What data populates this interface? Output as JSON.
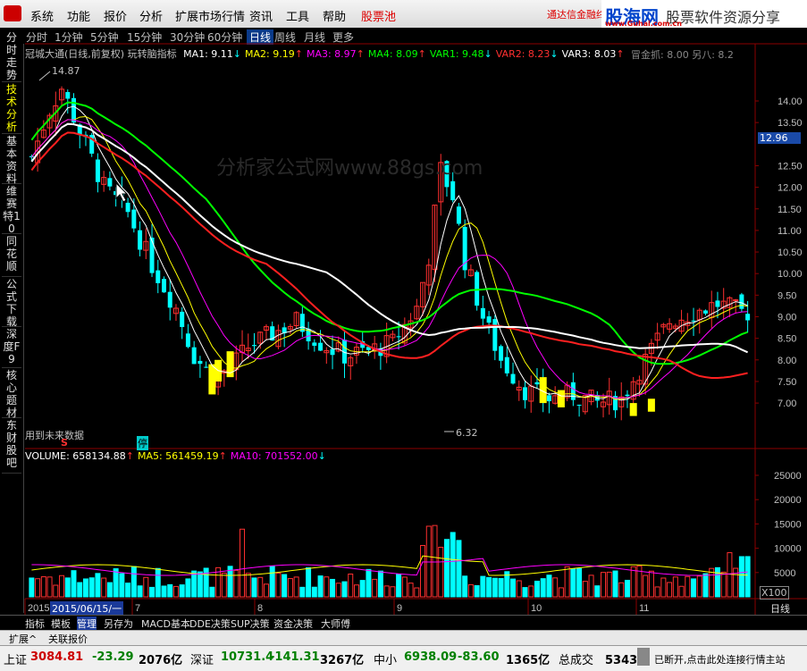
{
  "menubar": {
    "items": [
      "系统",
      "功能",
      "报价",
      "分析",
      "扩展市场行情",
      "资讯",
      "工具",
      "帮助"
    ],
    "red_item": "股票池",
    "right_text": "通达信金融终"
  },
  "brand": {
    "name": "股海网",
    "slogan": "股票软件资源分享",
    "url": "www.Guhai.com.cn"
  },
  "periods": [
    "分时",
    "1分钟",
    "5分钟",
    "15分钟",
    "30分钟",
    "60分钟",
    "日线",
    "周线",
    "月线",
    "更多"
  ],
  "active_period": "日线",
  "side_tabs": [
    {
      "label": "分时走势",
      "active": false
    },
    {
      "label": "技术分析",
      "active": true
    },
    {
      "label": "基本资料",
      "active": false
    },
    {
      "label": "维赛特10",
      "active": false
    },
    {
      "label": "同花顺",
      "active": false
    },
    {
      "label": "公式下载",
      "active": false
    },
    {
      "label": "深度F9",
      "active": false
    },
    {
      "label": "核心题材",
      "active": false
    },
    {
      "label": "东财股吧",
      "active": false
    }
  ],
  "indicator": {
    "title": "冠城大通(日线,前复权) 玩转脑指标",
    "items": [
      {
        "label": "MA1: 9.11",
        "arrow": "↓",
        "color": "#ffffff",
        "acolor": "#00ffff"
      },
      {
        "label": "MA2: 9.19",
        "arrow": "↑",
        "color": "#ffff00",
        "acolor": "#ff3030"
      },
      {
        "label": "MA3: 8.97",
        "arrow": "↑",
        "color": "#ff00ff",
        "acolor": "#ff3030"
      },
      {
        "label": "MA4: 8.09",
        "arrow": "↑",
        "color": "#00ff00",
        "acolor": "#ff3030"
      },
      {
        "label": "VAR1: 9.48",
        "arrow": "↓",
        "color": "#00ff00",
        "acolor": "#00ffff"
      },
      {
        "label": "VAR2: 8.23",
        "arrow": "↓",
        "color": "#ff3030",
        "acolor": "#00ffff"
      },
      {
        "label": "VAR3: 8.03",
        "arrow": "↑",
        "color": "#ffffff",
        "acolor": "#ff3030"
      }
    ],
    "overlay_text": "冒金抓: 8.00 另八: 8.2"
  },
  "watermark": "分析家公式网www.88gs.com",
  "price_axis": {
    "ticks": [
      "14.00",
      "13.50",
      "12.96",
      "12.50",
      "12.00",
      "11.50",
      "11.00",
      "10.50",
      "10.00",
      "9.50",
      "9.00",
      "8.50",
      "8.00",
      "7.50",
      "7.00"
    ],
    "current": "12.96"
  },
  "annotations": {
    "high": "14.87",
    "low": "6.32",
    "future_data": "用到未来数据",
    "s_mark": "S",
    "stop_mark": "停"
  },
  "volume": {
    "items": [
      {
        "label": "VOLUME: 658134.88",
        "arrow": "↑",
        "color": "#ffffff",
        "acolor": "#ff3030"
      },
      {
        "label": "MA5: 561459.19",
        "arrow": "↑",
        "color": "#ffff00",
        "acolor": "#ff3030"
      },
      {
        "label": "MA10: 701552.00",
        "arrow": "↓",
        "color": "#ff00ff",
        "acolor": "#00ffff"
      }
    ],
    "ticks": [
      "25000",
      "20000",
      "15000",
      "10000",
      "5000"
    ],
    "unit": "X100"
  },
  "date_axis": {
    "labels": [
      "2015",
      "7",
      "8",
      "9",
      "10",
      "11"
    ],
    "cursor_date": "2015/06/15/一",
    "period": "日线"
  },
  "bottom_tabs": [
    "指标",
    "模板",
    "管理",
    "另存为",
    "MACD基本",
    "DDE决策",
    "SUP决策",
    "资金决策",
    "大师傅"
  ],
  "active_bottom_tab": "管理",
  "ext_tabs": [
    "扩展^",
    "关联报价"
  ],
  "status": {
    "sh_label": "上证",
    "sh_value": "3084.81",
    "sh_change": "-23.29",
    "sh_amount": "2076亿",
    "sz_label": "深证",
    "sz_value": "10731.4",
    "sz_change": "-141.31",
    "sz_amount": "3267亿",
    "sm_label": "中小",
    "sm_value": "6938.09",
    "sm_change": "-83.60",
    "sm_amount": "1365亿",
    "total_label": "总成交",
    "total_value": "5343亿",
    "conn_text": "已断开,点击此处连接行情主站"
  },
  "colors": {
    "up": "#ff3030",
    "down": "#00ffff",
    "ma1": "#ffffff",
    "ma2": "#ffff00",
    "ma3": "#ff00ff",
    "ma4": "#00ff00"
  }
}
